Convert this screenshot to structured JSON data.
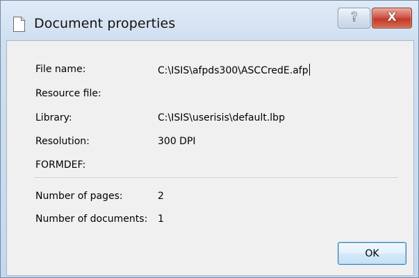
{
  "window": {
    "title": "Document properties"
  },
  "titlebar_buttons": {
    "help_glyph": "?",
    "close_glyph": "X"
  },
  "properties": [
    {
      "label": "File name:",
      "value": "C:\\ISIS\\afpds300\\ASCCredE.afp"
    },
    {
      "label": "Resource file:",
      "value": ""
    },
    {
      "label": "Library:",
      "value": "C:\\ISIS\\userisis\\default.lbp"
    },
    {
      "label": "Resolution:",
      "value": "300 DPI"
    },
    {
      "label": "FORMDEF:",
      "value": ""
    }
  ],
  "counts": [
    {
      "label": "Number of pages:",
      "value": "2"
    },
    {
      "label": "Number of documents:",
      "value": "1"
    }
  ],
  "ok_button": {
    "label": "OK"
  },
  "icons": {
    "title": "document-icon",
    "help": "help-icon",
    "close": "close-icon"
  },
  "colors": {
    "close_button": "#c94435",
    "ok_border": "#3c7fb1",
    "frame": "#cfdff0"
  }
}
